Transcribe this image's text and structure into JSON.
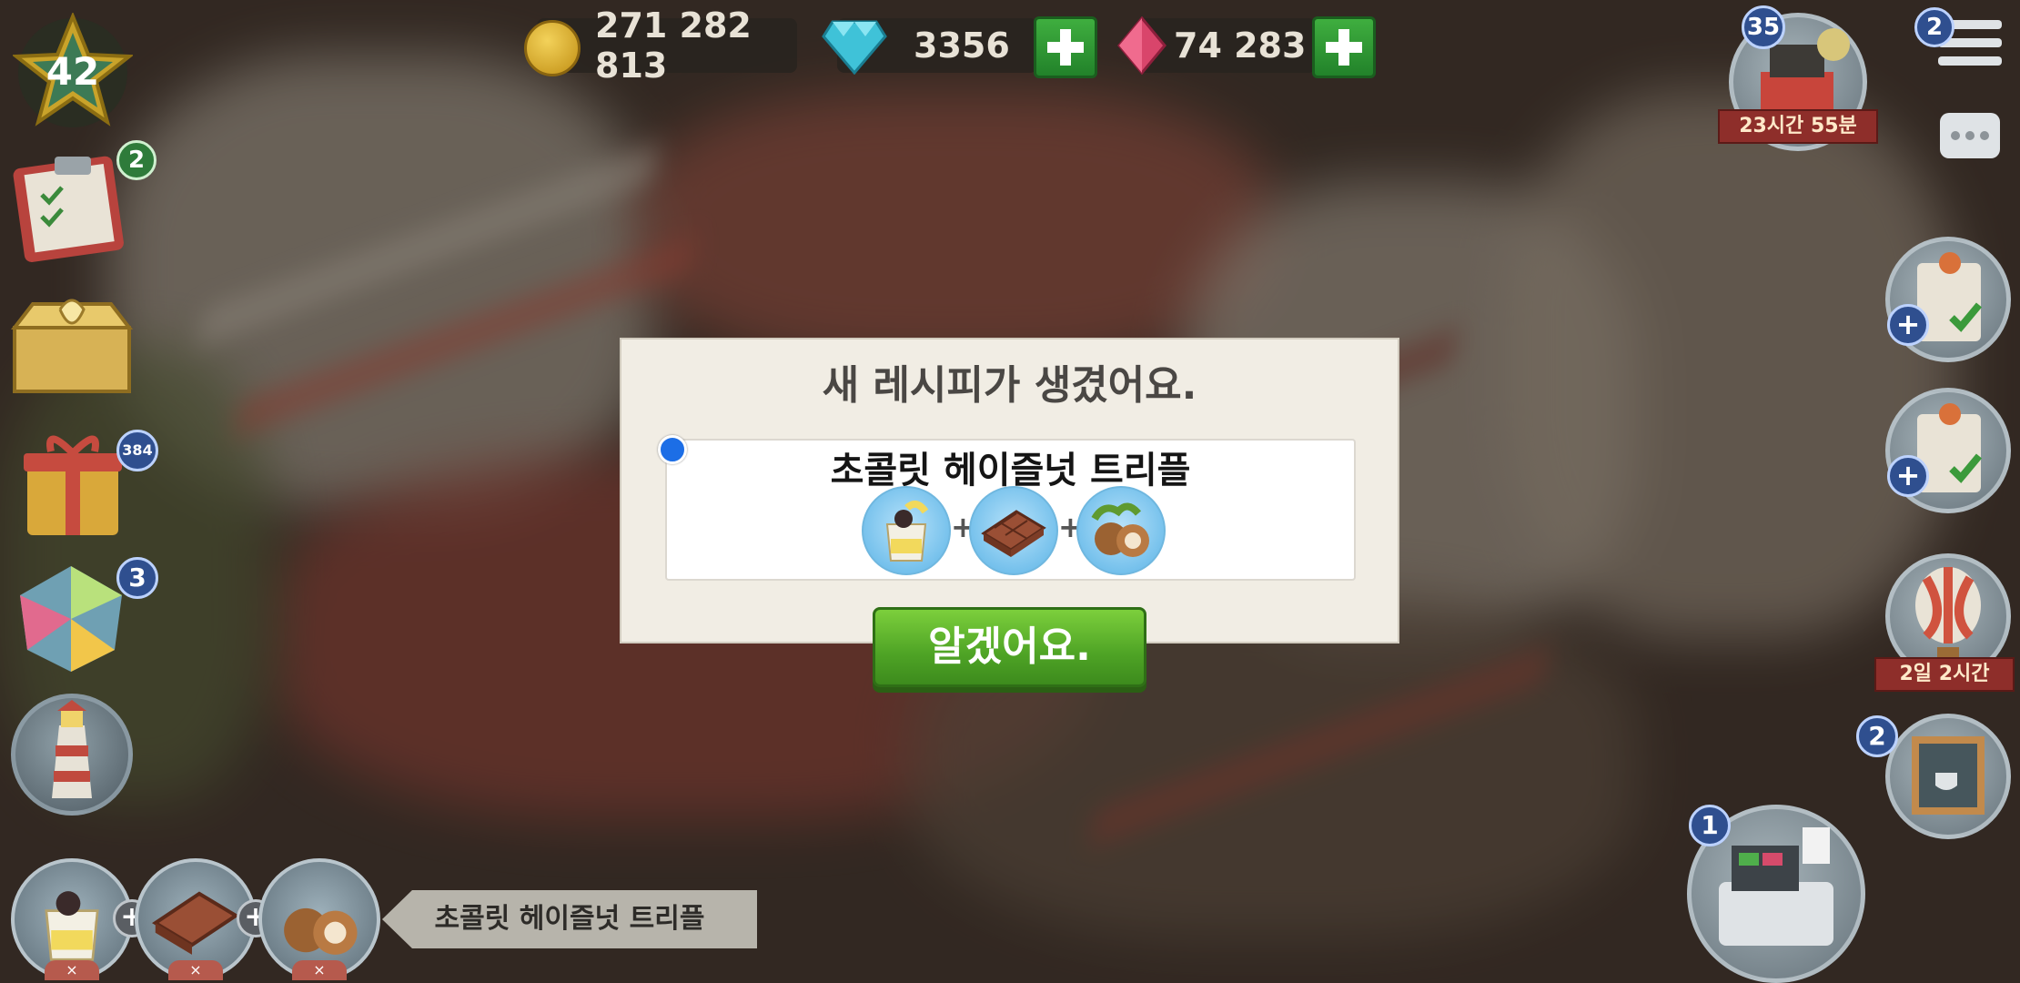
{
  "hud": {
    "level": "42",
    "coins": "271 282 813",
    "diamonds": "3356",
    "gems": "74 283",
    "menu_badge": "2",
    "event_level": "35",
    "event_timer": "23시간 55분",
    "balloon_timer": "2일 2시간",
    "board_badge": "2",
    "register_badge": "1"
  },
  "left_badges": {
    "tasks": "2",
    "gifts": "384",
    "gems_shop": "3"
  },
  "modal": {
    "title": "새 레시피가 생겼어요.",
    "recipe_name": "초콜릿 헤이즐넛 트리플",
    "ingredients": [
      "milk-drink",
      "chocolate-bar",
      "hazelnut"
    ],
    "plus": "+",
    "ok_label": "알겠어요."
  },
  "bottom": {
    "recipe_tag": "초콜릿 헤이즐넛 트리플",
    "remove": "×",
    "plus": "+"
  },
  "colors": {
    "ok_green": "#4ea325",
    "plus_green": "#2e8f33",
    "badge_blue": "#2f4f8f",
    "dot_blue": "#1c6ee6"
  }
}
